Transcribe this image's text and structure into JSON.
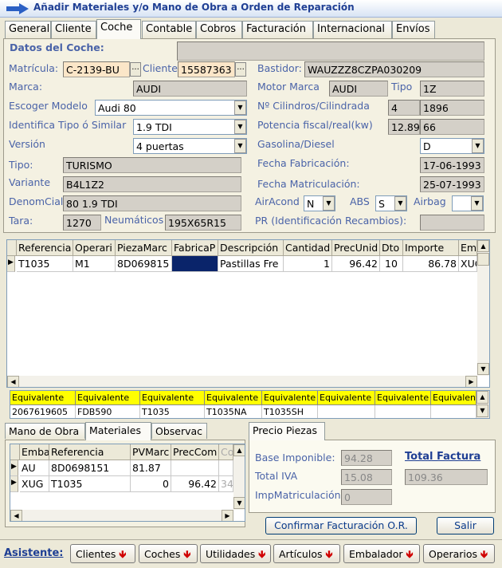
{
  "window": {
    "title": "Añadir Materiales y/o Mano de Obra a Orden de Reparación"
  },
  "tabs": [
    "General",
    "Cliente",
    "Coche",
    "Contable",
    "Cobros",
    "Facturación",
    "Internacional",
    "Envíos"
  ],
  "coche": {
    "section_title": "Datos del Coche:",
    "matricula_label": "Matrícula:",
    "matricula": "C-2139-BU",
    "cliente_label": "Cliente",
    "cliente": "15587363",
    "bastidor_label": "Bastidor:",
    "bastidor": "WAUZZZ8CZPA030209",
    "marca_label": "Marca:",
    "marca": "AUDI",
    "motor_marca_label": "Motor Marca",
    "motor_marca": "AUDI",
    "tipo_motor_label": "Tipo",
    "tipo_motor": "1Z",
    "modelo_label": "Escoger Modelo",
    "modelo": "Audi 80",
    "cilindros_label": "Nº Cilindros/Cilindrada",
    "cilindros": "4",
    "cilindrada": "1896",
    "identifica_label": "Identifica Tipo ó Similar",
    "identifica": "1.9 TDI",
    "potencia_label": "Potencia fiscal/real(kw)",
    "potencia_fiscal": "12.89",
    "potencia_real": "66",
    "version_label": "Versión",
    "version": "4 puertas",
    "combustible_label": "Gasolina/Diesel",
    "combustible": "D",
    "tipo_label": "Tipo:",
    "tipo": "TURISMO",
    "fecha_fab_label": "Fecha Fabricación:",
    "fecha_fab": "17-06-1993",
    "variante_label": "Variante",
    "variante": "B4L1Z2",
    "fecha_mat_label": "Fecha Matriculación:",
    "fecha_mat": "25-07-1993",
    "denom_label": "DenomCial",
    "denom": "80 1.9 TDI",
    "aircond_label": "AirAcond",
    "aircond": "N",
    "abs_label": "ABS",
    "abs": "S",
    "airbag_label": "Airbag",
    "airbag": "",
    "tara_label": "Tara:",
    "tara": "1270",
    "neumaticos_label": "Neumáticos",
    "neumaticos": "195X65R15",
    "pr_label": "PR (Identificación Recambios):",
    "pr": ""
  },
  "main_grid": {
    "headers": [
      "Referencia",
      "Operari",
      "PiezaMarc",
      "FabricaP",
      "Descripción",
      "Cantidad",
      "PrecUnid",
      "Dto",
      "Importe",
      "Em"
    ],
    "rows": [
      [
        "T1035",
        "M1",
        "8D069815",
        "",
        "Pastillas Fre",
        "1",
        "96.42",
        "10",
        "86.78",
        "XUG"
      ]
    ]
  },
  "equiv": {
    "headers": [
      "Equivalente",
      "Equivalente",
      "Equivalente",
      "Equivalente",
      "Equivalente",
      "Equivalente",
      "Equivalente",
      "Equivalent"
    ],
    "values": [
      "2067619605",
      "FDB590",
      "T1035",
      "T1035NA",
      "T1035SH",
      "",
      "",
      ""
    ]
  },
  "subtabs": [
    "Mano de Obra",
    "Materiales",
    "Observac"
  ],
  "mat_grid": {
    "headers": [
      "Emba",
      "Referencia",
      "PVMarc",
      "PrecCom",
      "Co"
    ],
    "rows": [
      [
        "AU",
        "8D0698151",
        "81.87",
        "",
        ""
      ],
      [
        "XUG",
        "T1035",
        "0",
        "96.42",
        "34"
      ]
    ]
  },
  "precio": {
    "tab": "Precio Piezas",
    "base_label": "Base Imponible:",
    "base": "94.28",
    "iva_label": "Total IVA",
    "iva": "15.08",
    "impmat_label": "ImpMatriculación",
    "impmat": "0",
    "total_label": "Total Factura",
    "total": "109.36"
  },
  "buttons": {
    "confirmar": "Confirmar Facturación O.R.",
    "salir": "Salir"
  },
  "toolbar": {
    "asistente": "Asistente:",
    "items": [
      "Clientes",
      "Coches",
      "Utilidades",
      "Artículos",
      "Embalador",
      "Operarios"
    ]
  }
}
